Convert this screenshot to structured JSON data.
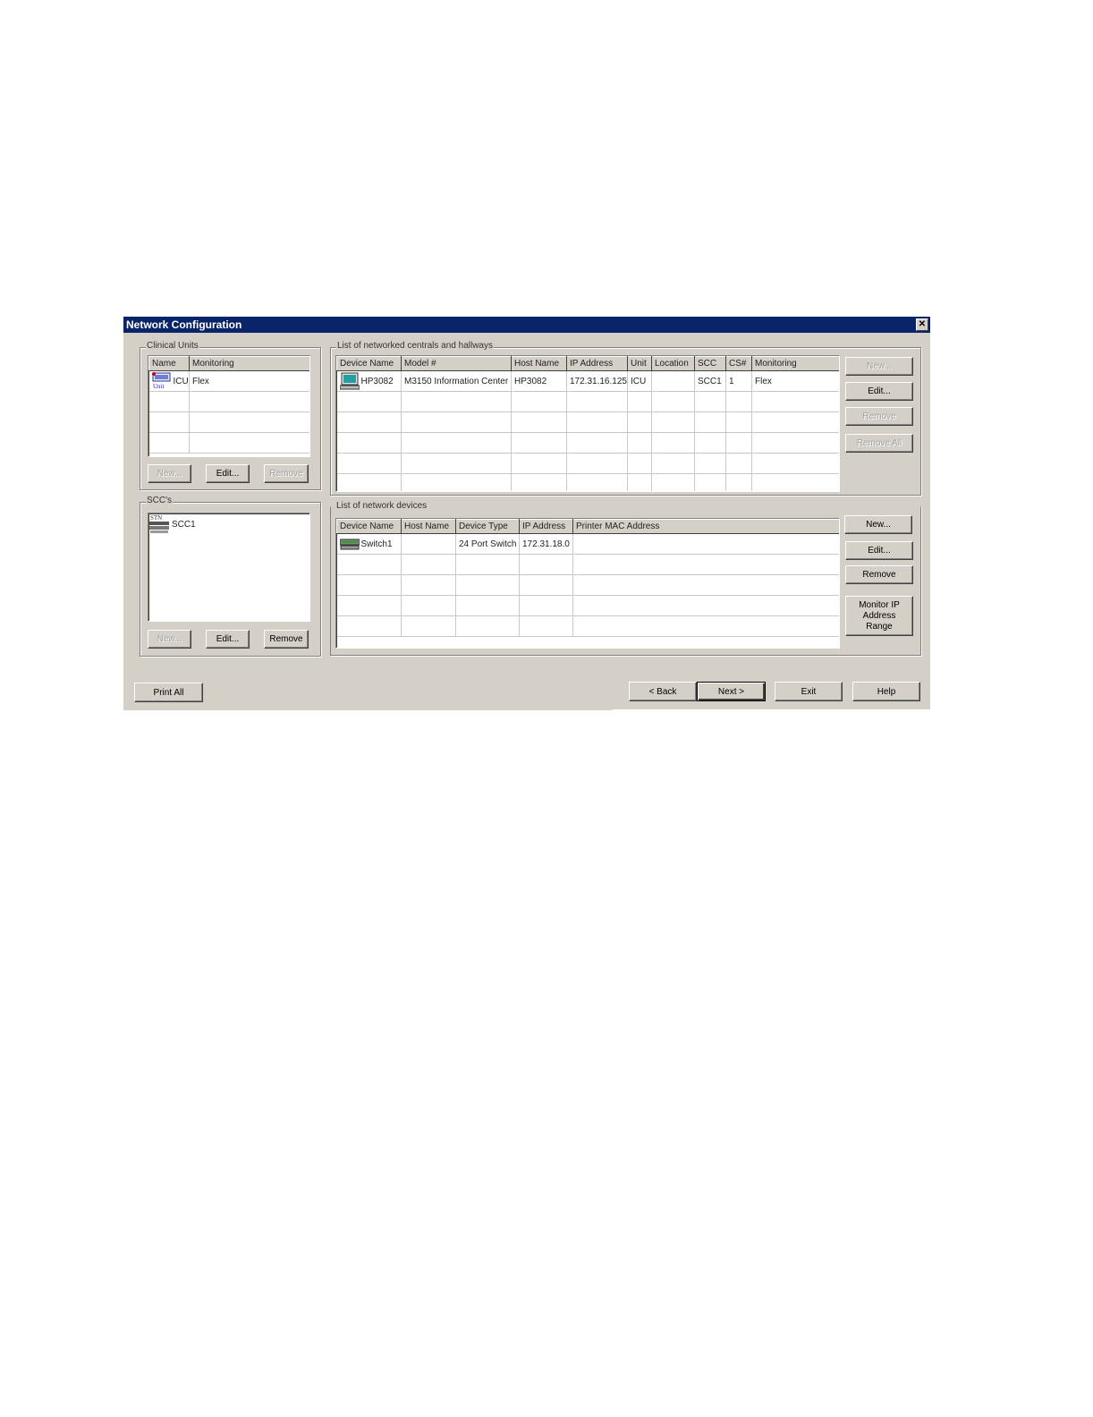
{
  "window": {
    "title": "Network Configuration",
    "close_icon": "close-icon"
  },
  "clinical_units": {
    "legend": "Clinical Units",
    "headers": [
      "Name",
      "Monitoring"
    ],
    "rows": [
      {
        "name": "ICU",
        "monitoring": "Flex",
        "icon": "unit-icon",
        "icon_text": "Unit"
      }
    ],
    "buttons": {
      "new": "New...",
      "edit": "Edit...",
      "remove": "Remove"
    }
  },
  "sccs": {
    "legend": "SCC's",
    "items": [
      {
        "name": "SCC1",
        "icon": "scc-switch-icon",
        "icon_text": "STN"
      }
    ],
    "buttons": {
      "new": "New...",
      "edit": "Edit...",
      "remove": "Remove"
    }
  },
  "centrals": {
    "legend": "List of networked centrals and hallways",
    "headers": [
      "Device Name",
      "Model #",
      "Host Name",
      "IP Address",
      "Unit",
      "Location",
      "SCC",
      "CS#",
      "Monitoring"
    ],
    "rows": [
      {
        "device_name": "HP3082",
        "model": "M3150 Information Center",
        "host_name": "HP3082",
        "ip": "172.31.16.125",
        "unit": "ICU",
        "location": "",
        "scc": "SCC1",
        "cs": "1",
        "monitoring": "Flex",
        "icon": "computer-monitor-icon"
      }
    ],
    "buttons": {
      "new": "New...",
      "edit": "Edit...",
      "remove": "Remove",
      "remove_all": "Remove All"
    }
  },
  "devices": {
    "legend": "List of network devices",
    "headers": [
      "Device Name",
      "Host Name",
      "Device Type",
      "IP Address",
      "Printer MAC Address"
    ],
    "rows": [
      {
        "device_name": "Switch1",
        "host_name": "",
        "device_type": "24 Port Switch",
        "ip": "172.31.18.0",
        "mac": "",
        "icon": "network-switch-icon"
      }
    ],
    "buttons": {
      "new": "New...",
      "edit": "Edit...",
      "remove": "Remove",
      "monitor_ip": [
        "Monitor IP",
        "Address",
        "Range"
      ]
    }
  },
  "footer": {
    "print_all": "Print All",
    "back": "< Back",
    "next": "Next >",
    "exit": "Exit",
    "help": "Help"
  }
}
